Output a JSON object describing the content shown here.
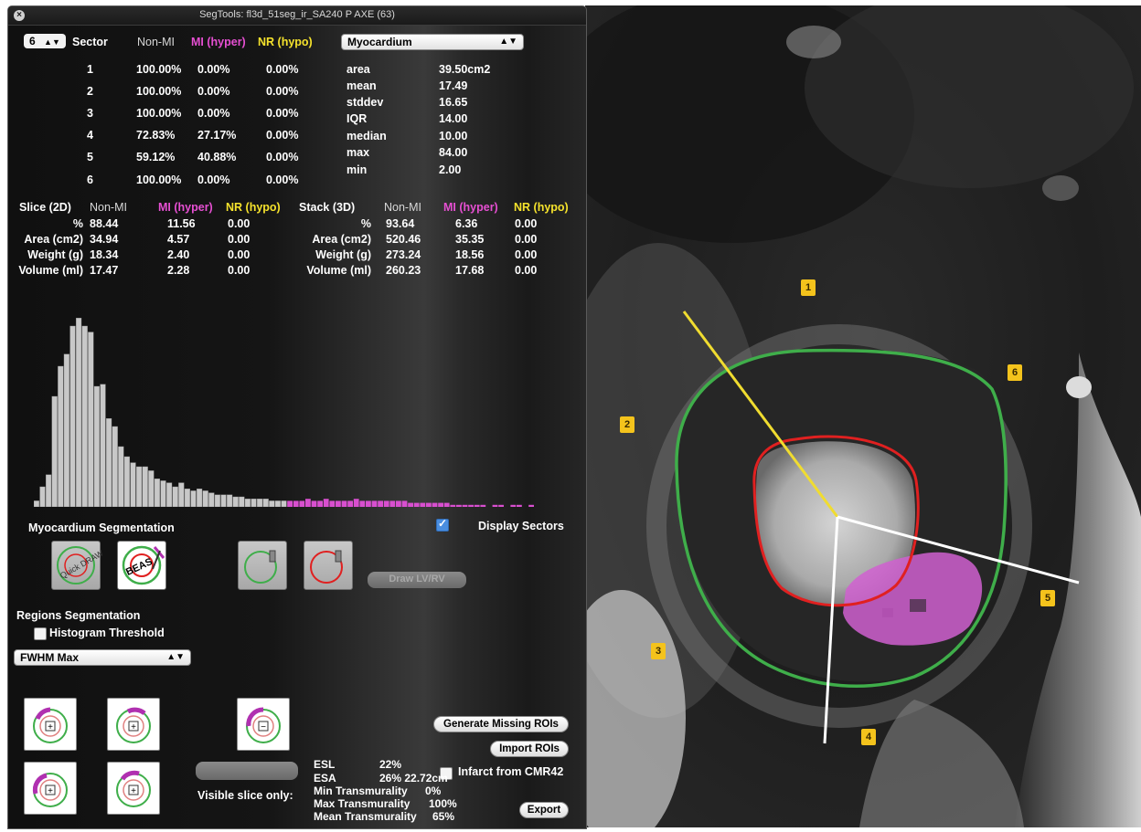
{
  "window": {
    "title": "SegTools: fl3d_51seg_ir_SA240 P AXE (63)"
  },
  "sectors": {
    "count": "6",
    "header": {
      "sector": "Sector",
      "non_mi": "Non-MI",
      "mi": "MI (hyper)",
      "nr": "NR (hypo)"
    },
    "rows": [
      {
        "id": "1",
        "non_mi": "100.00%",
        "mi": "0.00%",
        "nr": "0.00%"
      },
      {
        "id": "2",
        "non_mi": "100.00%",
        "mi": "0.00%",
        "nr": "0.00%"
      },
      {
        "id": "3",
        "non_mi": "100.00%",
        "mi": "0.00%",
        "nr": "0.00%"
      },
      {
        "id": "4",
        "non_mi": "72.83%",
        "mi": "27.17%",
        "nr": "0.00%"
      },
      {
        "id": "5",
        "non_mi": "59.12%",
        "mi": "40.88%",
        "nr": "0.00%"
      },
      {
        "id": "6",
        "non_mi": "100.00%",
        "mi": "0.00%",
        "nr": "0.00%"
      }
    ]
  },
  "region_select": {
    "value": "Myocardium"
  },
  "stats": [
    {
      "label": "area",
      "value": "39.50cm2"
    },
    {
      "label": "mean",
      "value": "17.49"
    },
    {
      "label": "stddev",
      "value": "16.65"
    },
    {
      "label": "IQR",
      "value": "14.00"
    },
    {
      "label": "median",
      "value": "10.00"
    },
    {
      "label": "max",
      "value": "84.00"
    },
    {
      "label": "min",
      "value": "2.00"
    }
  ],
  "slice_2d": {
    "header": {
      "title": "Slice (2D)",
      "non_mi": "Non-MI",
      "mi": "MI (hyper)",
      "nr": "NR (hypo)"
    },
    "rows": [
      {
        "label": "%",
        "non_mi": "88.44",
        "mi": "11.56",
        "nr": "0.00"
      },
      {
        "label": "Area (cm2)",
        "non_mi": "34.94",
        "mi": "4.57",
        "nr": "0.00"
      },
      {
        "label": "Weight (g)",
        "non_mi": "18.34",
        "mi": "2.40",
        "nr": "0.00"
      },
      {
        "label": "Volume (ml)",
        "non_mi": "17.47",
        "mi": "2.28",
        "nr": "0.00"
      }
    ]
  },
  "stack_3d": {
    "header": {
      "title": "Stack (3D)",
      "non_mi": "Non-MI",
      "mi": "MI (hyper)",
      "nr": "NR (hypo)"
    },
    "rows": [
      {
        "label": "%",
        "non_mi": "93.64",
        "mi": "6.36",
        "nr": "0.00"
      },
      {
        "label": "Area (cm2)",
        "non_mi": "520.46",
        "mi": "35.35",
        "nr": "0.00"
      },
      {
        "label": "Weight (g)",
        "non_mi": "273.24",
        "mi": "18.56",
        "nr": "0.00"
      },
      {
        "label": "Volume (ml)",
        "non_mi": "260.23",
        "mi": "17.68",
        "nr": "0.00"
      }
    ]
  },
  "histogram": {
    "gray_values": [
      3,
      10,
      16,
      55,
      70,
      76,
      90,
      94,
      90,
      87,
      60,
      61,
      44,
      40,
      30,
      25,
      22,
      20,
      20,
      18,
      14,
      13,
      12,
      10,
      12,
      9,
      8,
      9,
      8,
      7,
      6,
      6,
      6,
      5,
      5,
      4,
      4,
      4,
      4,
      3,
      3,
      3
    ],
    "magenta_values": [
      3,
      3,
      3,
      4,
      3,
      3,
      4,
      3,
      3,
      3,
      3,
      4,
      3,
      3,
      3,
      3,
      3,
      3,
      3,
      3,
      2,
      2,
      2,
      2,
      2,
      2,
      2,
      1,
      1,
      1,
      1,
      1,
      1,
      0,
      1,
      1,
      0,
      1,
      1,
      0,
      1
    ],
    "colors": {
      "gray": "#c8c8c8",
      "magenta": "#d84fcf"
    }
  },
  "myo_seg": {
    "title": "Myocardium Segmentation",
    "display_sectors_label": "Display Sectors",
    "display_sectors_checked": true,
    "quick_draw_label": "Quick DRAW",
    "beas_label": "BEAS",
    "lvrv_button": "Draw LV/RV"
  },
  "regions_seg": {
    "title": "Regions Segmentation",
    "histogram_threshold_label": "Histogram Threshold",
    "method_select": "FWHM Max"
  },
  "buttons": {
    "generate": "Generate Missing ROIs",
    "import": "Import ROIs",
    "export": "Export"
  },
  "infarct_from_cmr42": "Infarct from CMR42",
  "visible_slice_only": "Visible slice only:",
  "metrics": [
    {
      "label": "ESL",
      "value": "22%"
    },
    {
      "label": "ESA",
      "value": "26% 22.72cm"
    },
    {
      "label": "Min Transmurality",
      "value": "0%"
    },
    {
      "label": "Max Transmurality",
      "value": "100%"
    },
    {
      "label": "Mean Transmurality",
      "value": "65%"
    }
  ],
  "viewer": {
    "sector_labels": [
      "1",
      "2",
      "3",
      "4",
      "5",
      "6"
    ],
    "colors": {
      "epicardium": "#3fae4a",
      "endocardium": "#e02020",
      "first_sector_line": "#f0dc30",
      "sector_lines": "#ffffff",
      "infarct": "#d060d0"
    }
  }
}
